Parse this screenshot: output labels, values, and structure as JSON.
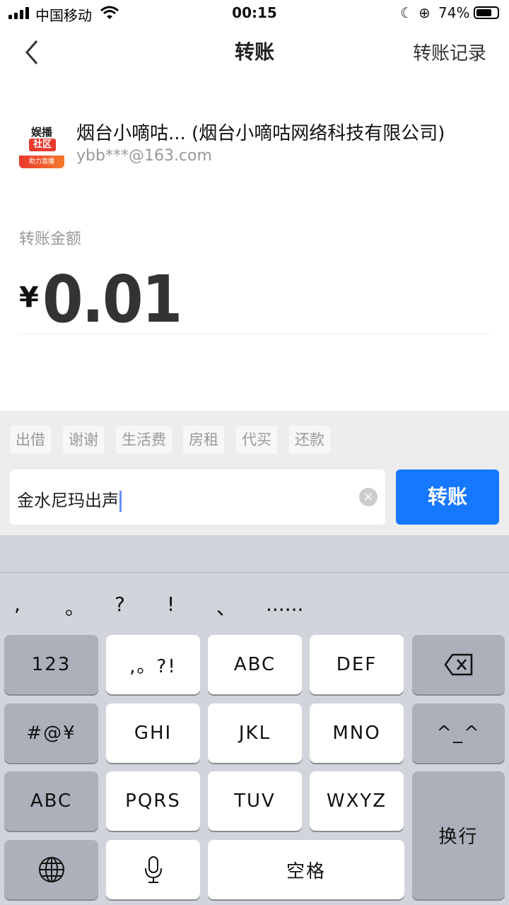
{
  "status_bar": {
    "carrier": "中国移动",
    "time": "00:15",
    "battery_pct": "74%"
  },
  "nav": {
    "back_icon": "chevron-left-icon",
    "title": "转账",
    "right_link": "转账记录"
  },
  "payee": {
    "logo_lines": [
      "娱播",
      "社区",
      "助力直播"
    ],
    "name": "烟台小嘀咕...  (烟台小嘀咕网络科技有限公司)",
    "account": "ybb***@163.com"
  },
  "amount": {
    "label": "转账金额",
    "currency": "¥",
    "value": "0.01"
  },
  "tags": [
    "出借",
    "谢谢",
    "生活费",
    "房租",
    "代买",
    "还款"
  ],
  "remark": {
    "value": "金水尼玛出声",
    "clear_icon": "clear-icon"
  },
  "send_button": "转账",
  "keyboard": {
    "candidates": [
      ",",
      "。",
      "?",
      "!",
      "、",
      "......"
    ],
    "keys": {
      "num": "123",
      "punct": ",。?!",
      "abc": "ABC",
      "def": "DEF",
      "sym": "#@¥",
      "ghi": "GHI",
      "jkl": "JKL",
      "mno": "MNO",
      "emoji": "^_^",
      "abc_switch": "ABC",
      "pqrs": "PQRS",
      "tuv": "TUV",
      "wxyz": "WXYZ",
      "return": "换行",
      "space": "空格"
    }
  },
  "colors": {
    "accent": "#1677ff",
    "caret": "#6b8cf2"
  }
}
